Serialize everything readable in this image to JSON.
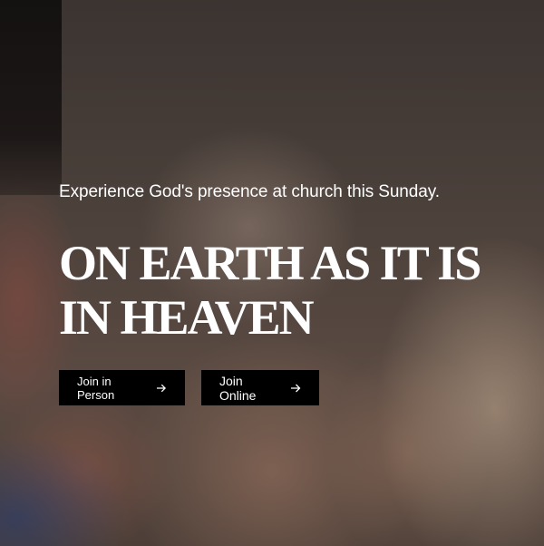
{
  "hero": {
    "tagline": "Experience God's presence at church this Sunday.",
    "headline_line1": "ON EARTH AS IT IS",
    "headline_line2": "IN HEAVEN",
    "background_icon": "blurred-photo"
  },
  "actions": {
    "join_in_person_label": "Join in Person",
    "join_online_label": "Join Online",
    "arrow_icon": "arrow-right-icon"
  },
  "colors": {
    "button_background": "#000000",
    "text": "#ffffff"
  }
}
